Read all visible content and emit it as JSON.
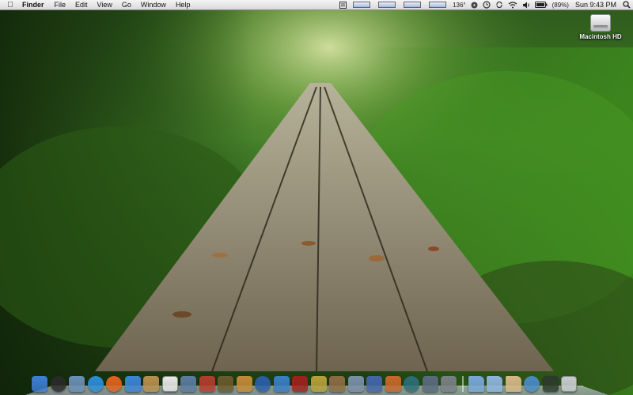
{
  "menubar": {
    "apple_glyph": "",
    "app_name": "Finder",
    "menus": [
      "File",
      "Edit",
      "View",
      "Go",
      "Window",
      "Help"
    ],
    "status": {
      "temperature": "136°",
      "battery": "(89%)",
      "clock": "Sun 9:43 PM"
    },
    "status_icons": [
      "script-icon",
      "cpu-meter-icon",
      "memory-meter-icon",
      "disk-meter-icon",
      "network-meter-icon",
      "fan-icon",
      "time-machine-icon",
      "wifi-icon",
      "volume-icon",
      "battery-icon",
      "spotlight-icon"
    ]
  },
  "desktop": {
    "drive_label": "Macintosh HD"
  },
  "dock": {
    "apps": [
      {
        "name": "finder-icon",
        "color": "#3d7fd6"
      },
      {
        "name": "dashboard-icon",
        "color": "#2a2a2a"
      },
      {
        "name": "preview-icon",
        "color": "#6b8fb8"
      },
      {
        "name": "safari-icon",
        "color": "#2c8fd9"
      },
      {
        "name": "firefox-icon",
        "color": "#e2641e"
      },
      {
        "name": "ichat-icon",
        "color": "#3a86d8"
      },
      {
        "name": "address-book-icon",
        "color": "#b8904f"
      },
      {
        "name": "ical-icon",
        "color": "#e9e9e9"
      },
      {
        "name": "iphoto-icon",
        "color": "#5b7ca0"
      },
      {
        "name": "photo-booth-icon",
        "color": "#b33d2d"
      },
      {
        "name": "starburst-app-icon",
        "color": "#6b5a2c"
      },
      {
        "name": "garageband-icon",
        "color": "#c48a3a"
      },
      {
        "name": "quicktime-icon",
        "color": "#2a5faa"
      },
      {
        "name": "itunes-icon",
        "color": "#3a7ec6"
      },
      {
        "name": "photo-app-icon",
        "color": "#a0211d"
      },
      {
        "name": "fruit-app-icon",
        "color": "#b6a03a"
      },
      {
        "name": "dictionary-icon",
        "color": "#8f6c44"
      },
      {
        "name": "script-editor-icon",
        "color": "#7a8faa"
      },
      {
        "name": "graph-app-icon",
        "color": "#4466aa"
      },
      {
        "name": "network-app-icon",
        "color": "#c6682c"
      },
      {
        "name": "time-machine-dock-icon",
        "color": "#2d6d7a"
      },
      {
        "name": "spaces-icon",
        "color": "#5a6a80"
      },
      {
        "name": "system-preferences-icon",
        "color": "#7a7f85"
      },
      {
        "name": "applications-folder-icon",
        "color": "#79a7d9"
      },
      {
        "name": "documents-folder-icon",
        "color": "#8fb4e0"
      },
      {
        "name": "downloads-stack-icon",
        "color": "#d7b886"
      },
      {
        "name": "network-globe-icon",
        "color": "#4a8ac5"
      },
      {
        "name": "activity-monitor-icon",
        "color": "#2c3a2c"
      },
      {
        "name": "trash-icon",
        "color": "#c8ccd0"
      }
    ]
  }
}
